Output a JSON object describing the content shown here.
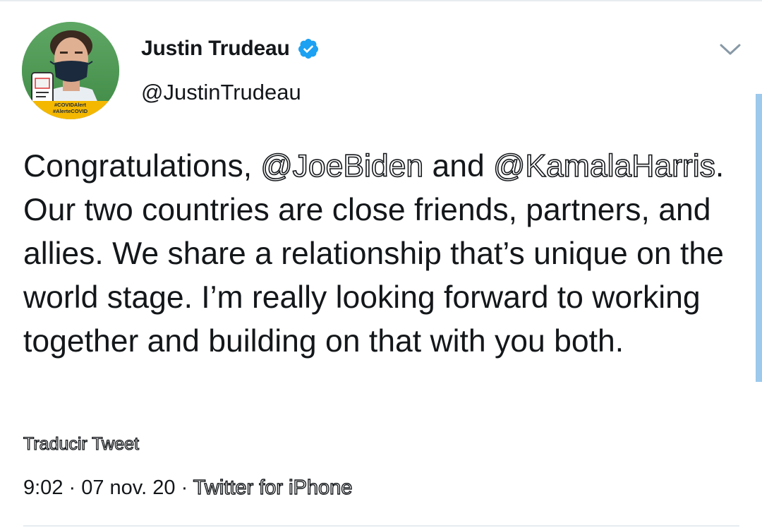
{
  "tweet": {
    "author_name": "Justin Trudeau",
    "handle": "@JustinTrudeau",
    "verified": true,
    "avatar_badge": {
      "line1": "#COVIDAlert",
      "line2": "#AlerteCOVID"
    },
    "body": {
      "part1": "Congratulations, ",
      "mention1": "@JoeBiden",
      "part2": " and ",
      "mention2": "@KamalaHarris",
      "part3": ". Our two countries are close friends, partners, and allies. We share a relationship that’s unique on the world stage. I’m really looking forward to working together and building on that with you both."
    },
    "translate_label": "Traducir Tweet",
    "time": "9:02",
    "separator": " · ",
    "date": "07 nov. 20",
    "source": "Twitter for iPhone"
  },
  "icons": {
    "verified": "verified-badge-icon",
    "menu": "chevron-down-icon"
  },
  "colors": {
    "verified_blue": "#1da1f2",
    "scrollbar": "#9cc9ec",
    "divider": "#e6ecf0",
    "text": "#14171a",
    "badge_yellow": "#f5b800"
  }
}
